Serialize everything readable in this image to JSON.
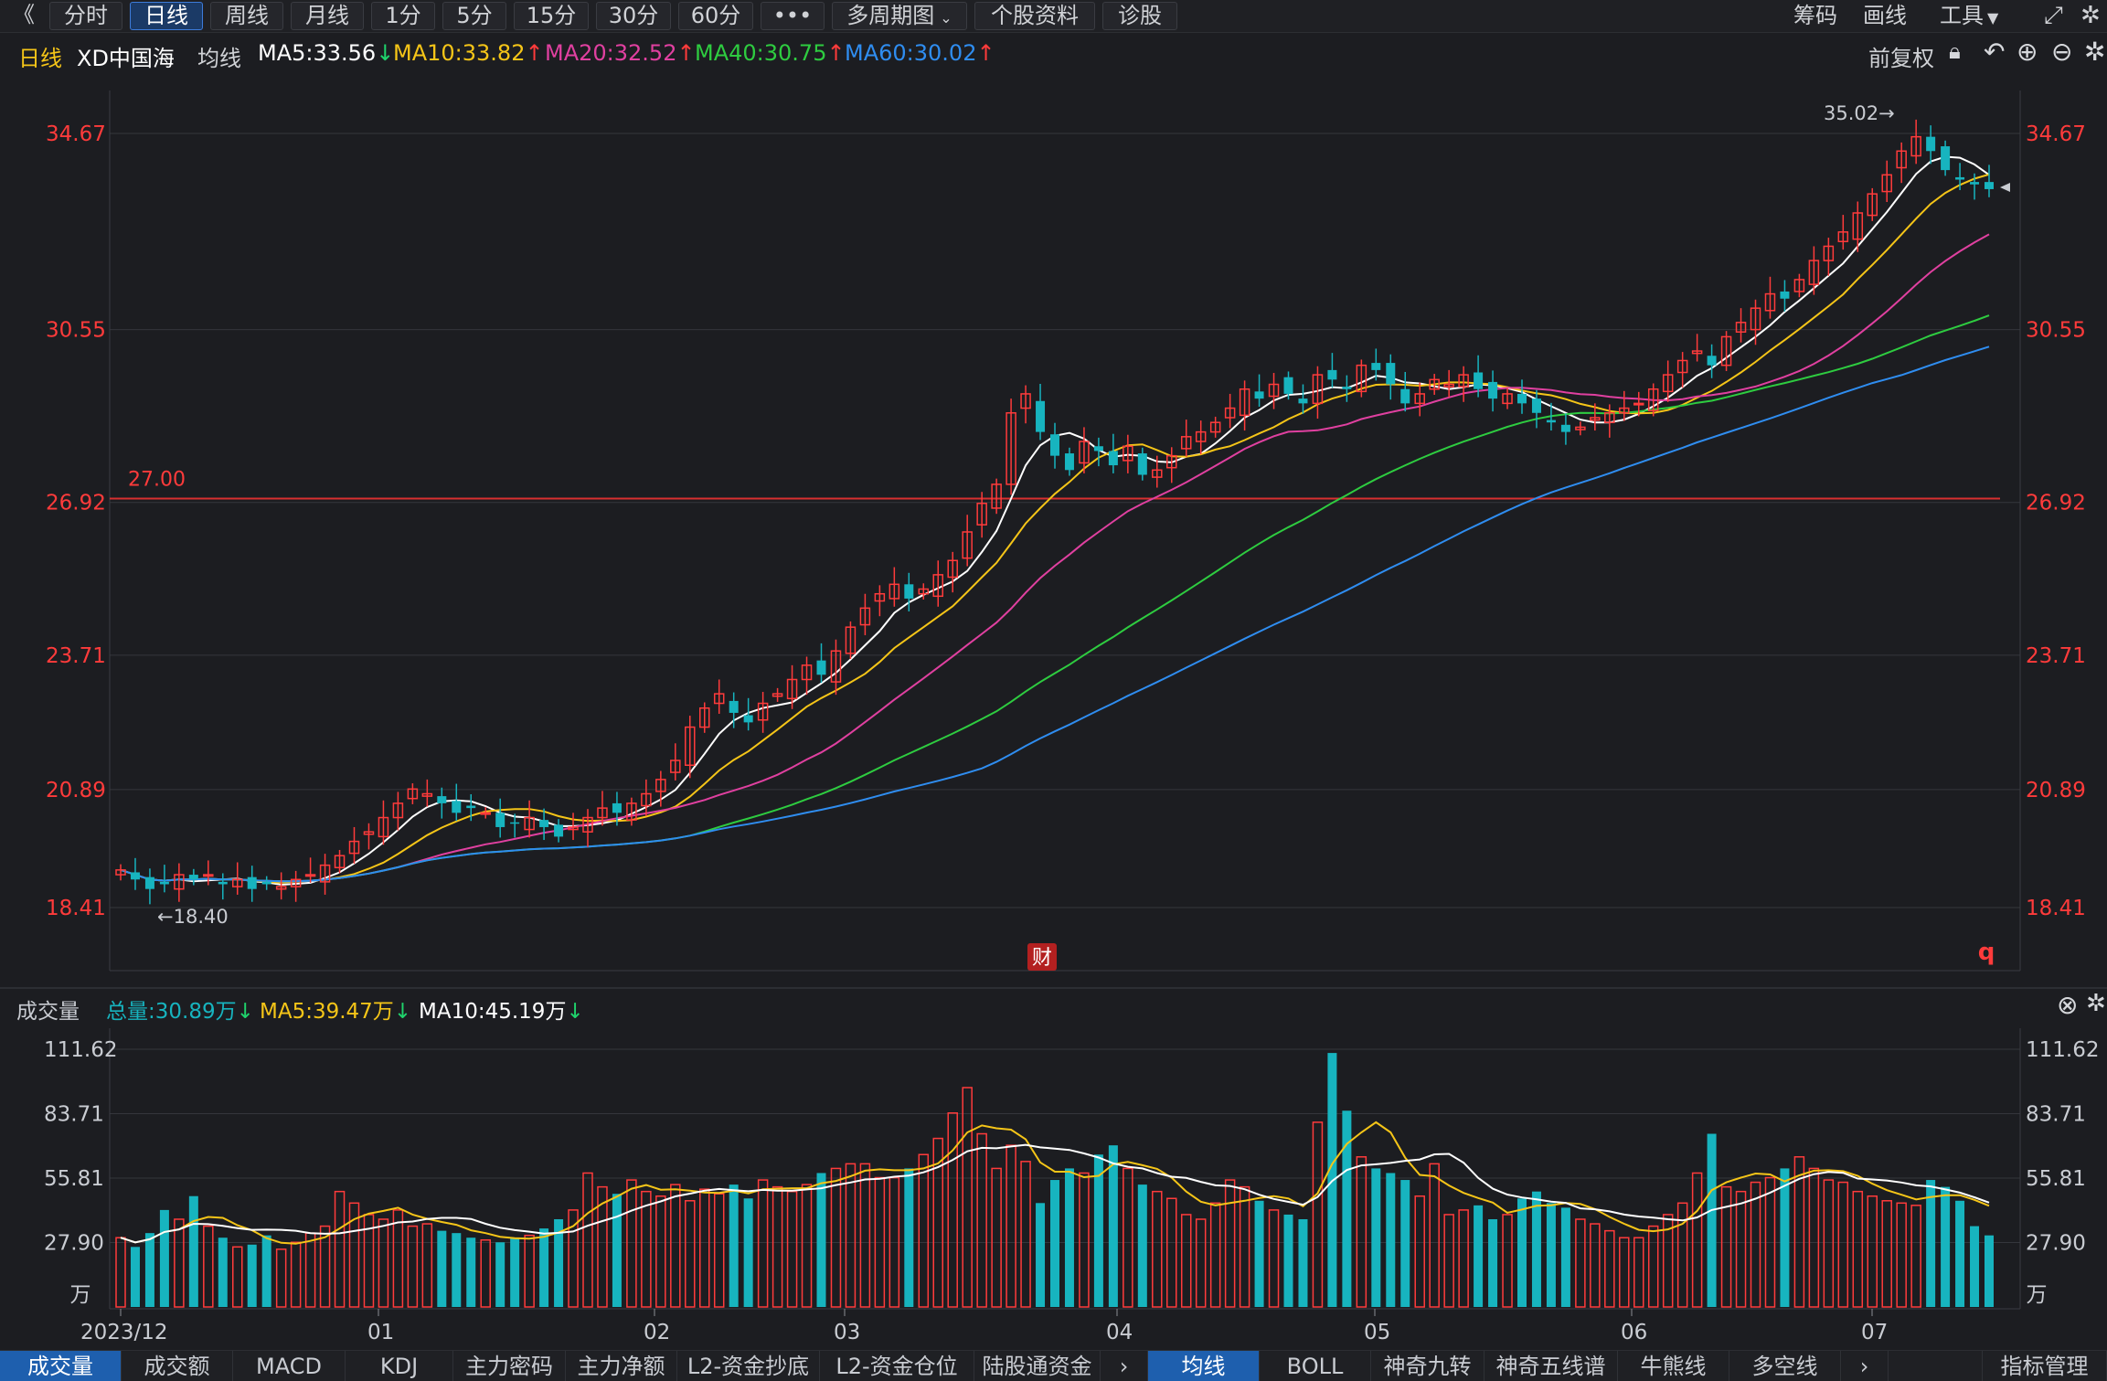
{
  "toolbar": {
    "back": "《",
    "tabs": [
      "分时",
      "日线",
      "周线",
      "月线",
      "1分",
      "5分",
      "15分",
      "30分",
      "60分",
      "•••",
      "多周期图",
      "个股资料",
      "诊股"
    ],
    "active": "日线",
    "right": [
      "筹码",
      "画线",
      "工具"
    ]
  },
  "info": {
    "period": "日线",
    "name": "XD中国海",
    "avg": "均线",
    "ma5": "MA5:33.56",
    "ma10": "MA10:33.82",
    "ma20": "MA20:32.52",
    "ma40": "MA40:30.75",
    "ma60": "MA60:30.02",
    "ma5_dir": "down",
    "ma10_dir": "up",
    "ma20_dir": "up",
    "ma40_dir": "up",
    "ma60_dir": "up",
    "adjust": "前复权"
  },
  "colors": {
    "up": "#ff3b3b",
    "down": "#17b4bf",
    "ma5": "#ffffff",
    "ma10": "#f5c518",
    "ma20": "#e040a0",
    "ma40": "#2ecc40",
    "ma60": "#2f8df0",
    "hline": "#d93030"
  },
  "price_axis": {
    "ticks": [
      "34.67",
      "30.55",
      "26.92",
      "23.71",
      "20.89",
      "18.41"
    ]
  },
  "annotations": {
    "high": "35.02→",
    "low": "←18.40",
    "hline_label": "27.00",
    "fin_badge": "财",
    "q_badge": "q"
  },
  "volume": {
    "title": "成交量",
    "total": "总量:30.89万",
    "ma5": "MA5:39.47万",
    "ma10": "MA10:45.19万",
    "ticks": [
      "111.62",
      "83.71",
      "55.81",
      "27.90"
    ],
    "unit": "万"
  },
  "x_axis": [
    "2023/12",
    "01",
    "02",
    "03",
    "04",
    "05",
    "06",
    "07"
  ],
  "bottom_tabs": [
    "成交量",
    "成交额",
    "MACD",
    "KDJ",
    "主力密码",
    "主力净额",
    "L2-资金抄底",
    "L2-资金仓位",
    "陆股通资金",
    "均线",
    "BOLL",
    "神奇九转",
    "神奇五线谱",
    "牛熊线",
    "多空线",
    "指标管理"
  ],
  "bottom_active": [
    "成交量",
    "均线"
  ],
  "chart_data": {
    "type": "candlestick",
    "series": [
      {
        "name": "MA5"
      },
      {
        "name": "MA10"
      },
      {
        "name": "MA20"
      },
      {
        "name": "MA40"
      },
      {
        "name": "MA60"
      }
    ],
    "y_range": [
      18.41,
      34.67
    ],
    "hline": 27.0,
    "high": 35.02,
    "low": 18.4,
    "closes": [
      19.2,
      19.0,
      18.8,
      18.9,
      19.1,
      19.0,
      19.1,
      18.9,
      19.0,
      18.8,
      18.9,
      18.85,
      19.0,
      19.1,
      19.3,
      19.5,
      19.8,
      20.0,
      20.3,
      20.6,
      20.9,
      20.8,
      20.6,
      20.4,
      20.5,
      20.4,
      20.1,
      20.2,
      20.3,
      20.1,
      19.9,
      20.1,
      20.3,
      20.5,
      20.4,
      20.6,
      20.8,
      21.1,
      21.5,
      22.2,
      22.6,
      22.9,
      22.5,
      22.3,
      22.7,
      22.9,
      23.2,
      23.5,
      23.3,
      23.8,
      24.3,
      24.7,
      25.0,
      25.2,
      24.9,
      25.1,
      25.4,
      25.7,
      26.3,
      26.9,
      27.3,
      28.8,
      29.2,
      28.4,
      27.9,
      27.6,
      28.2,
      28.0,
      27.7,
      28.1,
      27.5,
      27.6,
      27.9,
      28.3,
      28.4,
      28.6,
      28.9,
      29.3,
      29.1,
      29.4,
      29.2,
      29.0,
      29.6,
      29.5,
      29.3,
      29.8,
      29.7,
      29.4,
      29.0,
      29.2,
      29.5,
      29.4,
      29.6,
      29.3,
      29.1,
      29.2,
      29.0,
      28.8,
      28.6,
      28.4,
      28.5,
      28.7,
      28.8,
      28.9,
      29.0,
      29.3,
      29.6,
      29.9,
      30.1,
      29.8,
      30.4,
      30.7,
      31.0,
      31.3,
      31.2,
      31.6,
      32.0,
      32.3,
      32.6,
      33.0,
      33.4,
      33.8,
      34.3,
      34.6,
      34.3,
      33.9,
      33.7,
      33.6,
      33.5
    ],
    "volumes": [
      30,
      26,
      32,
      42,
      38,
      48,
      35,
      30,
      26,
      27,
      31,
      25,
      28,
      32,
      35,
      50,
      45,
      40,
      38,
      42,
      35,
      36,
      33,
      32,
      30,
      29,
      28,
      30,
      31,
      34,
      38,
      42,
      58,
      52,
      49,
      55,
      50,
      48,
      53,
      46,
      51,
      49,
      53,
      47,
      55,
      52,
      50,
      53,
      58,
      60,
      62,
      62,
      56,
      56,
      60,
      66,
      73,
      84,
      95,
      75,
      60,
      70,
      63,
      45,
      55,
      60,
      58,
      66,
      70,
      60,
      53,
      50,
      47,
      40,
      38,
      45,
      55,
      52,
      46,
      42,
      40,
      38,
      80,
      110,
      85,
      65,
      60,
      58,
      55,
      48,
      62,
      40,
      42,
      44,
      38,
      40,
      47,
      50,
      45,
      43,
      38,
      36,
      33,
      30,
      30,
      35,
      40,
      45,
      58,
      75,
      52,
      50,
      54,
      56,
      60,
      65,
      60,
      55,
      54,
      50,
      48,
      46,
      45,
      44,
      55,
      52,
      46,
      35,
      31
    ],
    "volume_range": [
      0,
      111.62
    ]
  }
}
